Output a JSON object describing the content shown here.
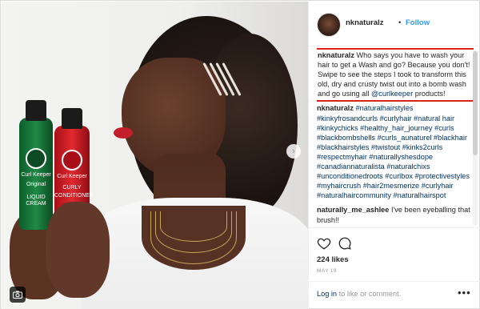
{
  "post": {
    "username": "nknaturalz",
    "separator": "•",
    "follow_label": "Follow",
    "caption": {
      "username": "nknaturalz",
      "text": "Who says you have to wash your hair to get a Wash and go? Because you don't! Swipe to see the steps I took to transform this old, dry and crusty twist out into a bomb wash and go using all",
      "mention": "@curlkeeper",
      "text_end": "products!"
    },
    "hashtag_comment": {
      "username": "nknaturalz",
      "hashtags": "#naturalhairstyles #kinkyfrosandcurls #curlyhair #natural hair #kinkychicks #healthy_hair_journey #curls #blackbombshells #curls_aunaturel #blackhair #blackhairstyles #twistout #kinks2curls #respectmyhair #naturallyshesdope #canadiannaturalista #naturalchixs #unconditionedroots #curlbox #protectivestyles #myhaircrush #hair2mesmerize #curlyhair #naturalhaircommunity #naturalhairspot"
    },
    "comment": {
      "username": "naturally_me_ashlee",
      "text": "I've been eyeballing that brush!!"
    },
    "likes": "224 likes",
    "date": "MAY 19",
    "login": {
      "link": "Log in",
      "rest": "to like or comment."
    },
    "more": "•••"
  },
  "photo": {
    "bottle_green": {
      "brand": "Curl Keeper",
      "line1": "Original",
      "line2": "LIQUID CREAM"
    },
    "bottle_red": {
      "brand": "Curl Keeper",
      "line1": "CURLY",
      "line2": "CONDITIONER"
    },
    "badge_icon": "camera-icon",
    "next_icon": "chevron-right-icon"
  },
  "colors": {
    "link_blue": "#3897f0",
    "hashtag": "#003569",
    "highlight_box": "#e0201b",
    "lipstick": "#c41e2a"
  }
}
